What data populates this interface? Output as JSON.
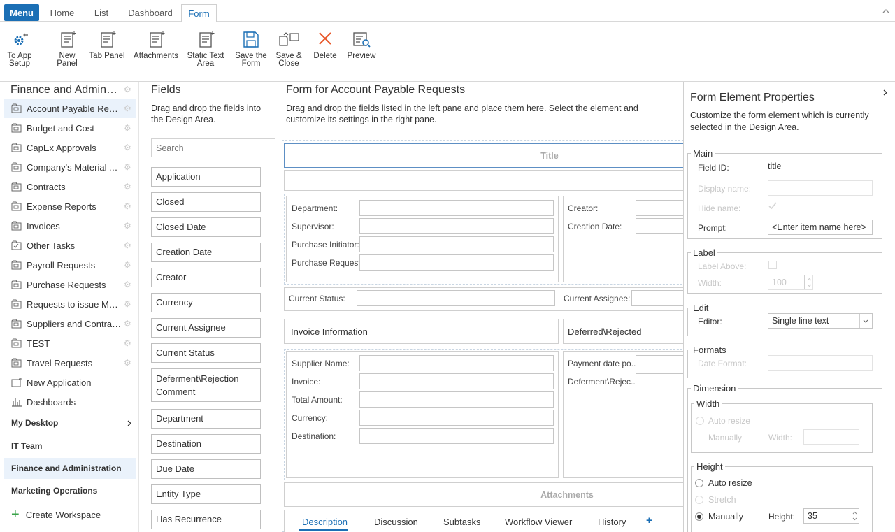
{
  "topbar": {
    "menu": "Menu",
    "tabs": [
      "Home",
      "List",
      "Dashboard",
      "Form"
    ],
    "active_tab": "Form"
  },
  "ribbon": {
    "buttons": [
      {
        "line1": "To App",
        "line2": "Setup",
        "icon": "gear-back-icon"
      },
      {
        "line1": "New",
        "line2": "Panel",
        "icon": "new-panel-icon"
      },
      {
        "line1": "Tab Panel",
        "line2": "",
        "icon": "tab-panel-icon"
      },
      {
        "line1": "Attachments",
        "line2": "",
        "icon": "attachments-icon"
      },
      {
        "line1": "Static Text",
        "line2": "Area",
        "icon": "static-text-icon"
      },
      {
        "line1": "Save the",
        "line2": "Form",
        "icon": "save-icon"
      },
      {
        "line1": "Save &",
        "line2": "Close",
        "icon": "save-close-icon"
      },
      {
        "line1": "Delete",
        "line2": "",
        "icon": "delete-icon"
      },
      {
        "line1": "Preview",
        "line2": "",
        "icon": "preview-icon"
      }
    ],
    "accent": "#1b6fb5",
    "delete_color": "#e8572a"
  },
  "nav": {
    "title": "Finance and Administration",
    "items": [
      "Account Payable Requests",
      "Budget and Cost",
      "CapEx Approvals",
      "Company's Material Assets",
      "Contracts",
      "Expense Reports",
      "Invoices",
      "Other Tasks",
      "Payroll Requests",
      "Purchase Requests",
      "Requests to issue Materials",
      "Suppliers and Contractors",
      "TEST",
      "Travel Requests"
    ],
    "new_app": "New Application",
    "dashboards": "Dashboards",
    "workspaces": [
      "My Desktop",
      "IT Team",
      "Finance and Administration",
      "Marketing Operations"
    ],
    "create_workspace": "Create Workspace"
  },
  "fields": {
    "title": "Fields",
    "desc": "Drag and drop the fields into the Design Area.",
    "search_placeholder": "Search",
    "items": [
      "Application",
      "Closed",
      "Closed Date",
      "Creation Date",
      "Creator",
      "Currency",
      "Current Assignee",
      "Current Status",
      "Deferment\\Rejection Comment",
      "Department",
      "Destination",
      "Due Date",
      "Entity Type",
      "Has Recurrence"
    ]
  },
  "design": {
    "title": "Form for Account Payable Requests",
    "desc": "Drag and drop the fields listed in the left pane and place them here. Select the element and customize its settings in the right pane.",
    "title_placeholder": "Title",
    "left_labels_1": [
      "Department:",
      "Supervisor:",
      "Purchase Initiator:",
      "Purchase Request:"
    ],
    "right_labels_1": [
      "Creator:",
      "Creation Date:"
    ],
    "current_status": "Current Status:",
    "current_assignee": "Current Assignee:",
    "invoice_info": "Invoice Information",
    "deferred": "Deferred\\Rejected",
    "left_labels_2": [
      "Supplier Name:",
      "Invoice:",
      "Total Amount:",
      "Currency:",
      "Destination:"
    ],
    "right_labels_2": [
      "Payment date po...",
      "Deferment\\Rejec..."
    ],
    "attachments": "Attachments",
    "tabs": [
      "Description",
      "Discussion",
      "Subtasks",
      "Workflow Viewer",
      "History"
    ],
    "add_tab": "+"
  },
  "props": {
    "title": "Form Element Properties",
    "desc": "Customize the form element which is currently selected in the Design Area.",
    "main": {
      "legend": "Main",
      "field_id_label": "Field ID:",
      "field_id": "title",
      "display_name_label": "Display name:",
      "hide_name_label": "Hide name:",
      "prompt_label": "Prompt:",
      "prompt_value": "<Enter item name here>"
    },
    "label": {
      "legend": "Label",
      "label_above": "Label Above:",
      "width_label": "Width:",
      "width_value": "100"
    },
    "edit": {
      "legend": "Edit",
      "editor_label": "Editor:",
      "editor_value": "Single line text"
    },
    "formats": {
      "legend": "Formats",
      "date_format_label": "Date Format:"
    },
    "dimension": {
      "legend": "Dimension",
      "width_legend": "Width",
      "auto_resize": "Auto resize",
      "manually": "Manually",
      "width_label": "Width:",
      "height_legend": "Height",
      "h_auto_resize": "Auto resize",
      "h_stretch": "Stretch",
      "h_manually": "Manually",
      "height_label": "Height:",
      "height_value": "35"
    }
  }
}
